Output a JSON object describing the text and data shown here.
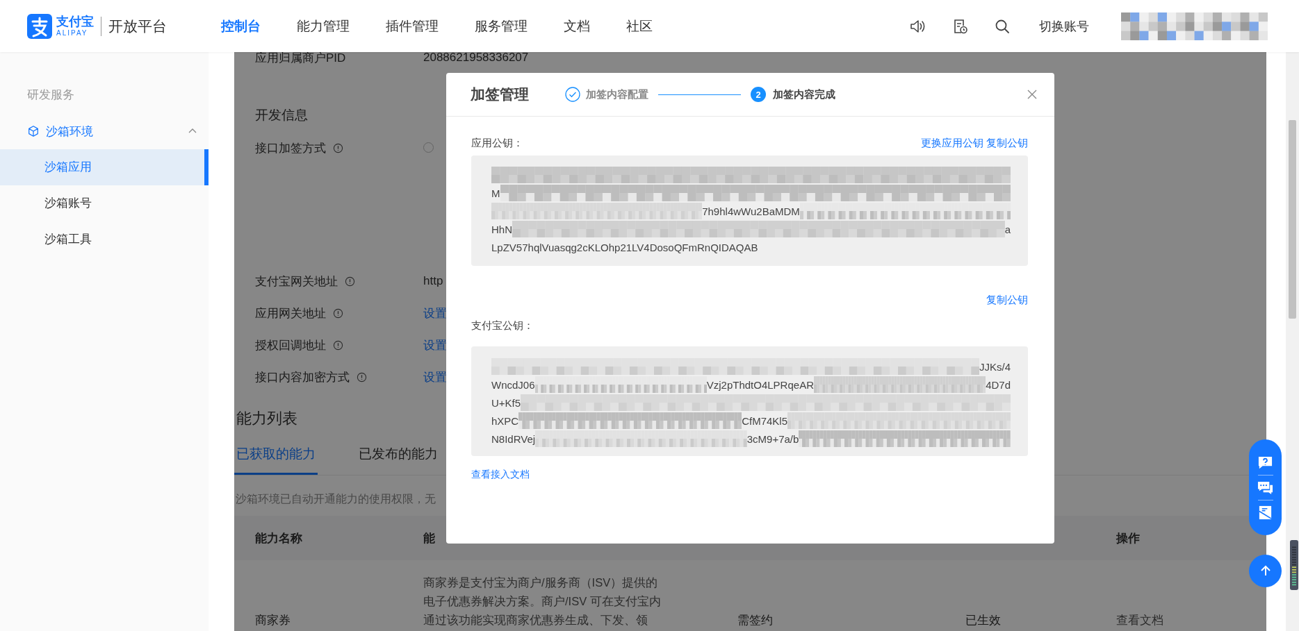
{
  "header": {
    "logo": {
      "name": "支付宝",
      "sub": "ALIPAY"
    },
    "product": "开放平台",
    "nav": [
      {
        "label": "控制台",
        "selected": true
      },
      {
        "label": "能力管理",
        "selected": false
      },
      {
        "label": "插件管理",
        "selected": false
      },
      {
        "label": "服务管理",
        "selected": false
      },
      {
        "label": "文档",
        "selected": false
      },
      {
        "label": "社区",
        "selected": false
      }
    ],
    "switch_account": "切换账号"
  },
  "sidebar": {
    "section": "研发服务",
    "groups": [
      {
        "label": "沙箱环境",
        "expanded": true,
        "children": [
          {
            "label": "沙箱应用",
            "selected": true
          },
          {
            "label": "沙箱账号",
            "selected": false
          },
          {
            "label": "沙箱工具",
            "selected": false
          }
        ]
      }
    ]
  },
  "app_info": {
    "pid_label": "应用归属商户PID",
    "pid_value": "2088621958336207"
  },
  "dev_info": {
    "title": "开发信息",
    "rows": [
      {
        "kind": "radio",
        "label": "接口加签方式",
        "checked": false
      },
      {
        "kind": "text",
        "label": "支付宝网关地址",
        "value": "http"
      },
      {
        "kind": "link",
        "label": "应用网关地址",
        "value": "设置"
      },
      {
        "kind": "link",
        "label": "授权回调地址",
        "value": "设置"
      },
      {
        "kind": "link",
        "label": "接口内容加密方式",
        "value": "设置"
      }
    ]
  },
  "abilities": {
    "title": "能力列表",
    "tabs": [
      {
        "label": "已获取的能力",
        "selected": true
      },
      {
        "label": "已发布的能力",
        "selected": false
      }
    ],
    "notice": "沙箱环境已自动开通能力的使用权限，无",
    "table": {
      "columns": [
        "能力名称",
        "能",
        "操作"
      ],
      "rows": [
        {
          "name": "商家券",
          "description": "商家券是支付宝为商户/服务商（ISV）提供的电子优惠券解决方案。商户/ISV 可在支付宝内通过该功能实现商家优惠券生成、下发、领",
          "sign": "需签约",
          "status": "已生效",
          "action": "查看文档"
        }
      ]
    }
  },
  "modal": {
    "title": "加签管理",
    "steps": [
      {
        "label": "加签内容配置",
        "done": true
      },
      {
        "number": "2",
        "label": "加签内容完成",
        "done": false
      }
    ],
    "app_key": {
      "label": "应用公钥：",
      "actions": [
        "更换应用公钥",
        "复制公钥"
      ],
      "lines": [
        [
          {
            "kind": "mosaic"
          }
        ],
        [
          {
            "kind": "text",
            "text": "M"
          },
          {
            "kind": "mosaic"
          }
        ],
        [
          {
            "kind": "mosaic"
          },
          {
            "kind": "text",
            "text": "7h9hl4wWu2BaMDM"
          },
          {
            "kind": "mosaic"
          }
        ],
        [
          {
            "kind": "text",
            "text": "HhN"
          },
          {
            "kind": "mosaic"
          },
          {
            "kind": "text",
            "text": "a"
          }
        ],
        [
          {
            "kind": "text",
            "text": "LpZV57hqlVuasqg2cKLOhp21LV4DosoQFmRnQIDAQAB"
          }
        ]
      ]
    },
    "copy_link": "复制公钥",
    "alipay_key": {
      "label": "支付宝公钥：",
      "lines": [
        [
          {
            "kind": "mosaic"
          },
          {
            "kind": "text",
            "text": "JJKs/4"
          }
        ],
        [
          {
            "kind": "text",
            "text": "WncdJ06"
          },
          {
            "kind": "mosaic"
          },
          {
            "kind": "text",
            "text": "Vzj2pThdtO4LPRqeAR"
          },
          {
            "kind": "mosaic"
          },
          {
            "kind": "text",
            "text": "4D7d"
          }
        ],
        [
          {
            "kind": "text",
            "text": "U+Kf5"
          },
          {
            "kind": "mosaic"
          }
        ],
        [
          {
            "kind": "text",
            "text": "hXPC"
          },
          {
            "kind": "mosaic"
          },
          {
            "kind": "text",
            "text": "CfM74Kl5"
          },
          {
            "kind": "mosaic"
          }
        ],
        [
          {
            "kind": "text",
            "text": "N8IdRVej"
          },
          {
            "kind": "mosaic"
          },
          {
            "kind": "text",
            "text": "3cM9+7a/b"
          },
          {
            "kind": "mosaic"
          }
        ]
      ]
    },
    "doc_link": "查看接入文档"
  }
}
